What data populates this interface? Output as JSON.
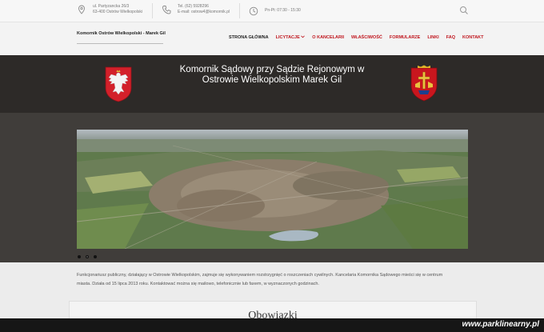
{
  "topbar": {
    "address": {
      "line1": "ul. Partyzancka 26/3",
      "line2": "63-400 Ostrów Wielkopolski"
    },
    "contact": {
      "line1": "Tel. (62) 5928296",
      "line2": "E-mail: ostrow4@komornik.pl"
    },
    "hours": {
      "line1": "Pn-Pt: 07:30 - 15:30"
    },
    "icons": {
      "address": "map-pin-icon",
      "contact": "phone-icon",
      "hours": "clock-icon",
      "search": "search-icon"
    }
  },
  "navbar": {
    "brand": "Komornik Ostrów Wielkopolski - Marek Gil",
    "items": [
      {
        "label": "Strona główna",
        "active": true
      },
      {
        "label": "Licytacje",
        "dropdown": true
      },
      {
        "label": "O kancelarii"
      },
      {
        "label": "Właściwość"
      },
      {
        "label": "Formularze"
      },
      {
        "label": "Linki"
      },
      {
        "label": "FAQ"
      },
      {
        "label": "Kontakt"
      }
    ]
  },
  "hero": {
    "title_line1": "Komornik Sądowy przy Sądzie Rejonowym w",
    "title_line2": "Ostrowie Wielkopolskim Marek Gil"
  },
  "slider": {
    "slides": 3,
    "active_index": 1
  },
  "intro": {
    "line1": "Funkcjonariusz publiczny, działający w Ostrowie Wielkopolskim, zajmuje się wykonywaniem rozstrzygnięć o roszczeniach cywilnych. Kancelaria Komornika Sądowego mieści się w centrum",
    "line2": "miasta. Działa od 15 lipca 2013 roku. Kontaktować można się mailowo, telefonicznie lub faxem, w wyznaczonych godzinach."
  },
  "section": {
    "title": "Obowiązki"
  },
  "watermark": "www.parklinearny.pl",
  "colors": {
    "accent": "#c0161e",
    "hero_bg": "#2d2a28",
    "slider_bg": "#403d3a"
  }
}
